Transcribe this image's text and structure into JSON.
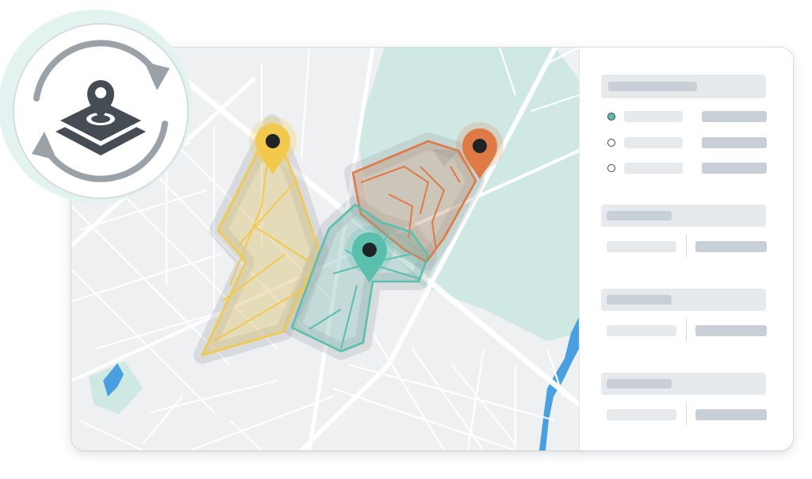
{
  "colors": {
    "map_bg": "#eef0f1",
    "park": "#cfe8e4",
    "water": "#4a9fe0",
    "road": "#ffffff",
    "yellow": "#f2c94c",
    "orange": "#e07a45",
    "teal": "#5bbfae",
    "radio_selected": "#5bbfae",
    "icon_dark": "#454c53",
    "arrows": "#9aa1a7",
    "badge_halo": "#e3f3f0"
  },
  "icons": {
    "badge": "map-layers-sync-icon",
    "pin": "location-pin-icon"
  },
  "territories": [
    {
      "name": "yellow",
      "pin_color": "#f2c94c"
    },
    {
      "name": "orange",
      "pin_color": "#e07a45"
    },
    {
      "name": "teal",
      "pin_color": "#5bbfae"
    }
  ],
  "panel": {
    "radio_options": [
      {
        "selected": true
      },
      {
        "selected": false
      },
      {
        "selected": false
      }
    ],
    "section_count": 3
  }
}
